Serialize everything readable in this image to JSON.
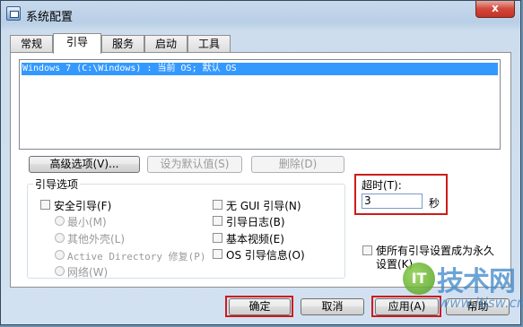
{
  "window": {
    "title": "系统配置",
    "close_label": "x"
  },
  "tabs": [
    {
      "label": "常规"
    },
    {
      "label": "引导"
    },
    {
      "label": "服务"
    },
    {
      "label": "启动"
    },
    {
      "label": "工具"
    }
  ],
  "os_list": {
    "selected_entry": "Windows 7 (C:\\Windows) : 当前 OS; 默认 OS"
  },
  "buttons": {
    "advanced": "高级选项(V)...",
    "set_default": "设为默认值(S)",
    "delete": "删除(D)"
  },
  "boot_options": {
    "legend": "引导选项",
    "safe_boot": "安全引导(F)",
    "minimal": "最小(M)",
    "alternate_shell": "其他外壳(L)",
    "ad_repair": "Active Directory 修复(P)",
    "network": "网络(W)",
    "no_gui_boot": "无 GUI 引导(N)",
    "boot_log": "引导日志(B)",
    "base_video": "基本视频(E)",
    "os_boot_info": "OS 引导信息(O)"
  },
  "timeout": {
    "label": "超时(T):",
    "value": "3",
    "unit": "秒"
  },
  "permanent": {
    "label_line1": "使所有引导设置成为永久",
    "label_line2": "设置(K)"
  },
  "footer": {
    "ok": "确定",
    "cancel": "取消",
    "apply": "应用(A)",
    "help": "帮助"
  },
  "watermark": {
    "circle": "IT",
    "text": "技术网",
    "url": "www.itjsw.cn"
  },
  "colors": {
    "highlight": "#3399ff",
    "annotation_red": "#d01a1a"
  }
}
